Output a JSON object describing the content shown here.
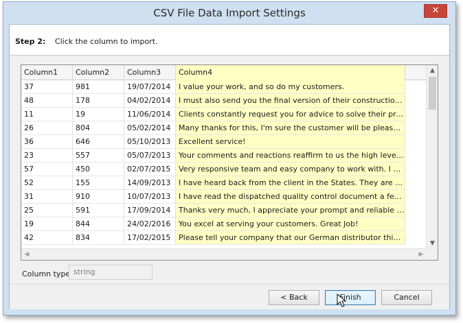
{
  "window": {
    "title": "CSV File Data Import Settings",
    "close_glyph": "✕"
  },
  "step": {
    "label": "Step 2:",
    "instruction": "Click the column to import."
  },
  "grid": {
    "columns": [
      "Column1",
      "Column2",
      "Column3",
      "Column4"
    ],
    "selected_column": "Column4",
    "rows": [
      [
        "37",
        "981",
        "19/07/2014",
        "I value your work, and so do my customers."
      ],
      [
        "48",
        "178",
        "04/02/2014",
        "I must also send you the final version of their construction which ..."
      ],
      [
        "11",
        "19",
        "11/06/2014",
        "Clients constantly request you for advice to solve their problems. ..."
      ],
      [
        "26",
        "804",
        "05/02/2014",
        "Many thanks for this, I'm sure the customer will be pleased with it."
      ],
      [
        "36",
        "646",
        "05/10/2013",
        "Excellent service!"
      ],
      [
        "23",
        "557",
        "05/07/2013",
        "Your comments and reactions reaffirm to us the high level of prof..."
      ],
      [
        "57",
        "450",
        "02/07/2015",
        "Very responsive team and easy company to work with.  I enjoy o..."
      ],
      [
        "52",
        "155",
        "14/09/2013",
        "I have heard back from the client in the States. They are very ple..."
      ],
      [
        "31",
        "910",
        "10/07/2013",
        "I have read the dispatched quality control document a few times ..."
      ],
      [
        "25",
        "591",
        "17/09/2014",
        "Thanks very much, I appreciate your prompt and reliable service."
      ],
      [
        "19",
        "844",
        "24/02/2016",
        "You excel at serving your customers. Great Job!"
      ],
      [
        "42",
        "834",
        "17/02/2015",
        "Please tell your company that our German distributor thinks his se..."
      ]
    ]
  },
  "column_type": {
    "label": "Column type:",
    "value": "string"
  },
  "buttons": {
    "back": "< Back",
    "finish": "Finish",
    "cancel": "Cancel"
  },
  "colors": {
    "selected_column": "#ffffc4",
    "close_button": "#c7463a",
    "frame": "#cfe0f0"
  }
}
